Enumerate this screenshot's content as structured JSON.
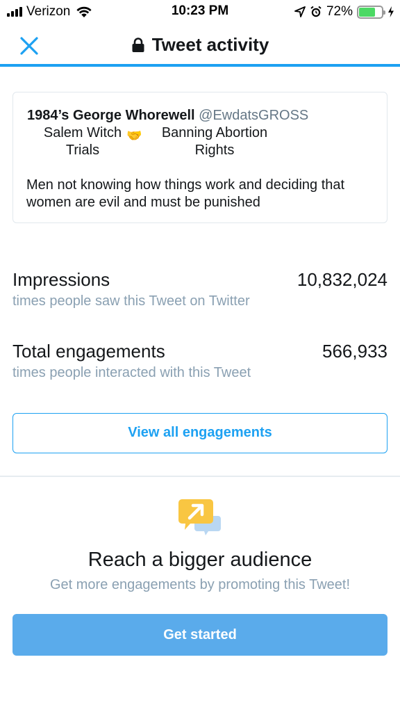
{
  "status_bar": {
    "carrier": "Verizon",
    "time": "10:23 PM",
    "battery_percent": "72%",
    "battery_level": 0.72,
    "icons": [
      "signal-icon",
      "wifi-icon",
      "location-arrow-icon",
      "alarm-icon",
      "battery-icon",
      "charging-bolt-icon"
    ]
  },
  "nav": {
    "title": "Tweet activity",
    "close_icon": "close-icon",
    "lock_icon": "lock-icon"
  },
  "tweet": {
    "author_name": "1984’s George Whorewell",
    "author_handle": "@EwdatsGROSS",
    "column_a": "Salem Witch\nTrials",
    "column_b": "Banning Abortion\nRights",
    "emoji": "🤝",
    "text": "Men not knowing how things work and deciding that women are evil and must be punished"
  },
  "metrics": {
    "impressions": {
      "label": "Impressions",
      "value": "10,832,024",
      "description": "times people saw this Tweet on Twitter"
    },
    "engagements": {
      "label": "Total engagements",
      "value": "566,933",
      "description": "times people interacted with this Tweet"
    }
  },
  "view_all_label": "View all engagements",
  "promote": {
    "title": "Reach a bigger audience",
    "subtitle": "Get more engagements by promoting this Tweet!",
    "button_label": "Get started"
  },
  "colors": {
    "accent": "#1da1f2",
    "button_fill": "#5aabeb",
    "muted_text": "#8aa0b2",
    "battery_green": "#4cd964",
    "promo_yellow": "#f9c642"
  }
}
